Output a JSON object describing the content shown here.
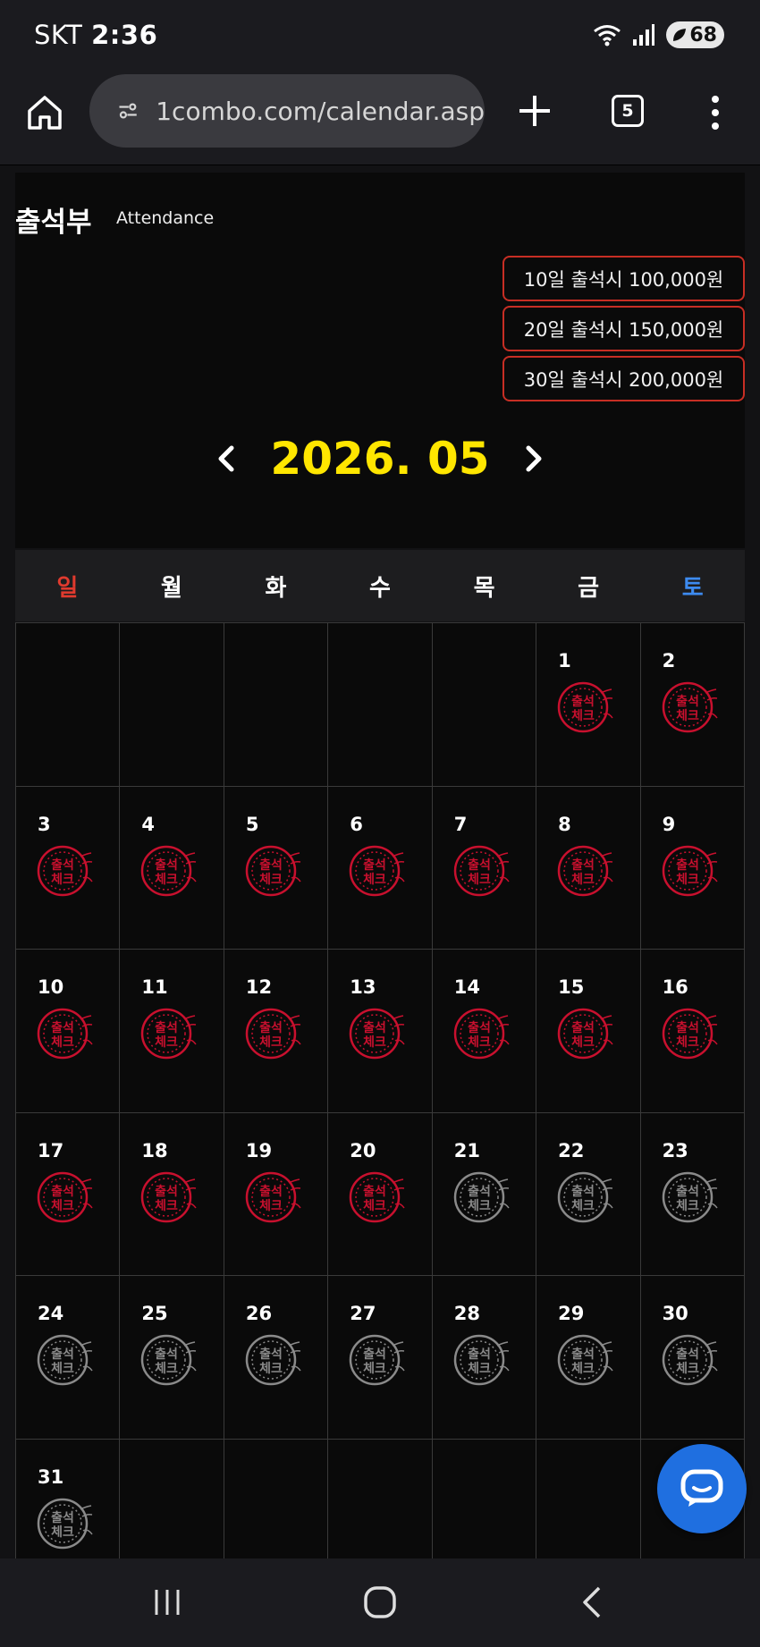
{
  "status_bar": {
    "carrier": "SKT",
    "time": "2:36",
    "battery": "68"
  },
  "browser": {
    "url": "1combo.com/calendar.asp",
    "tab_count": "5"
  },
  "header": {
    "title": "출석부",
    "subtitle": "Attendance"
  },
  "rewards": [
    {
      "label": "10일 출석시 100,000원"
    },
    {
      "label": "20일 출석시 150,000원"
    },
    {
      "label": "30일 출석시 200,000원"
    }
  ],
  "month_label": "2026. 05",
  "weekdays": [
    "일",
    "월",
    "화",
    "수",
    "목",
    "금",
    "토"
  ],
  "calendar": {
    "leading_blanks": 5,
    "days_in_month": 31,
    "checked_through": 20,
    "stamp_text_top": "출석",
    "stamp_text_bottom": "체크",
    "colors": {
      "checked": "#c8102e",
      "unchecked": "#8a8a8a"
    }
  },
  "colors": {
    "month_label": "#ffe600",
    "sunday": "#e03a2e",
    "saturday": "#3d8bf0",
    "reward_border": "#c72e24",
    "chat_button": "#1f6fe0"
  }
}
